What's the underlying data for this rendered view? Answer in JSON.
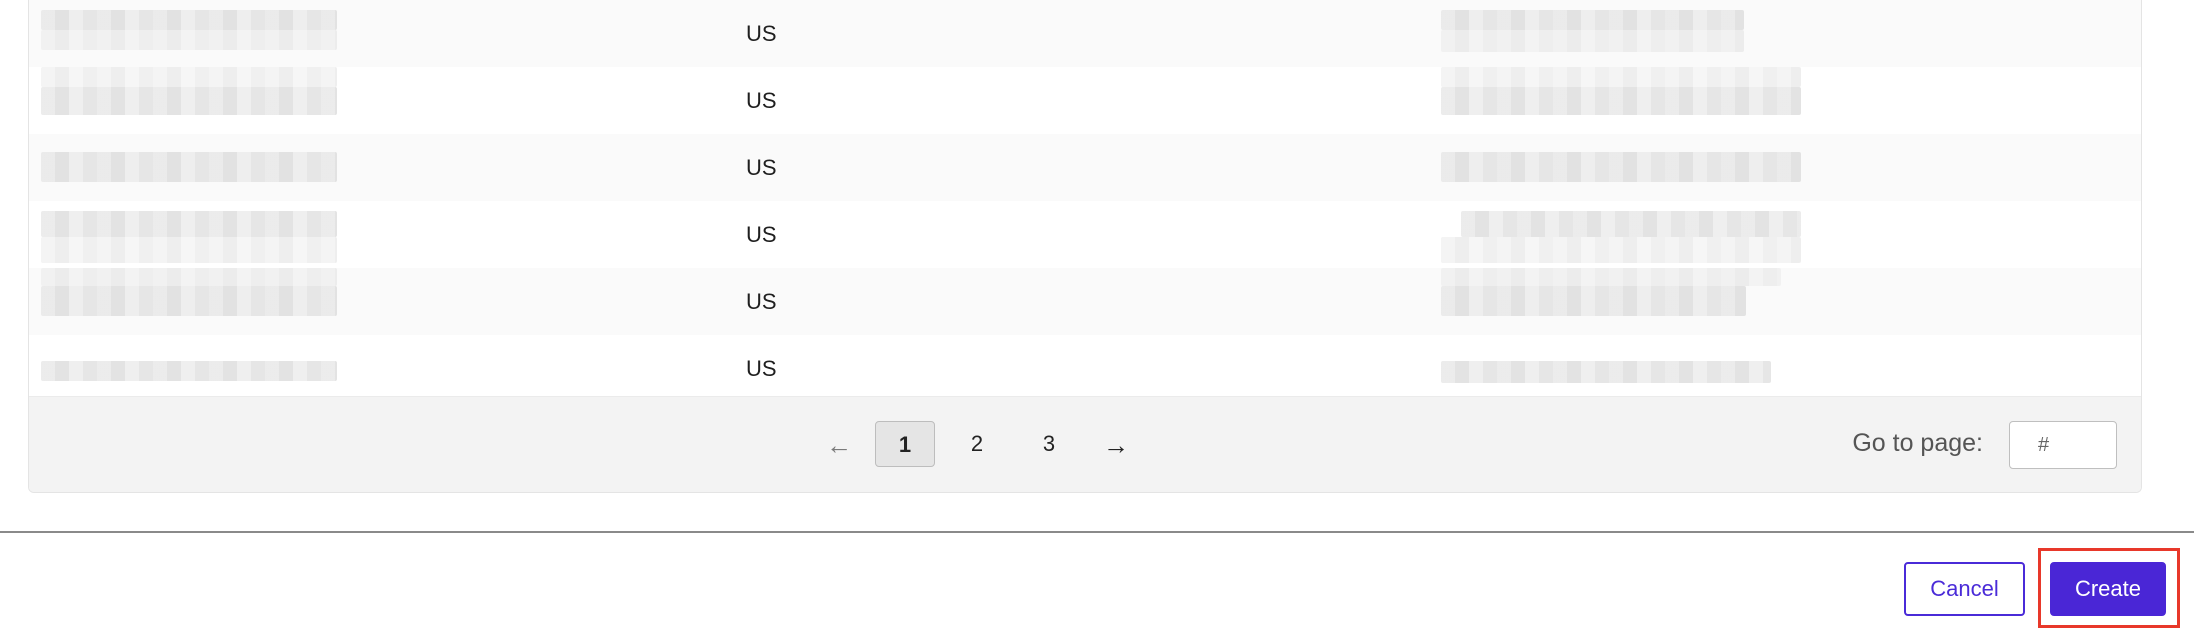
{
  "table": {
    "rows": [
      {
        "country": "US"
      },
      {
        "country": "US"
      },
      {
        "country": "US"
      },
      {
        "country": "US"
      },
      {
        "country": "US"
      },
      {
        "country": "US"
      }
    ]
  },
  "pagination": {
    "prev_icon": "←",
    "next_icon": "→",
    "pages": [
      "1",
      "2",
      "3"
    ],
    "current_page": "1",
    "goto_label": "Go to page:",
    "goto_placeholder": "#"
  },
  "footer": {
    "cancel_label": "Cancel",
    "create_label": "Create"
  },
  "colors": {
    "primary": "#4a26d6",
    "highlight": "#e8382a"
  }
}
